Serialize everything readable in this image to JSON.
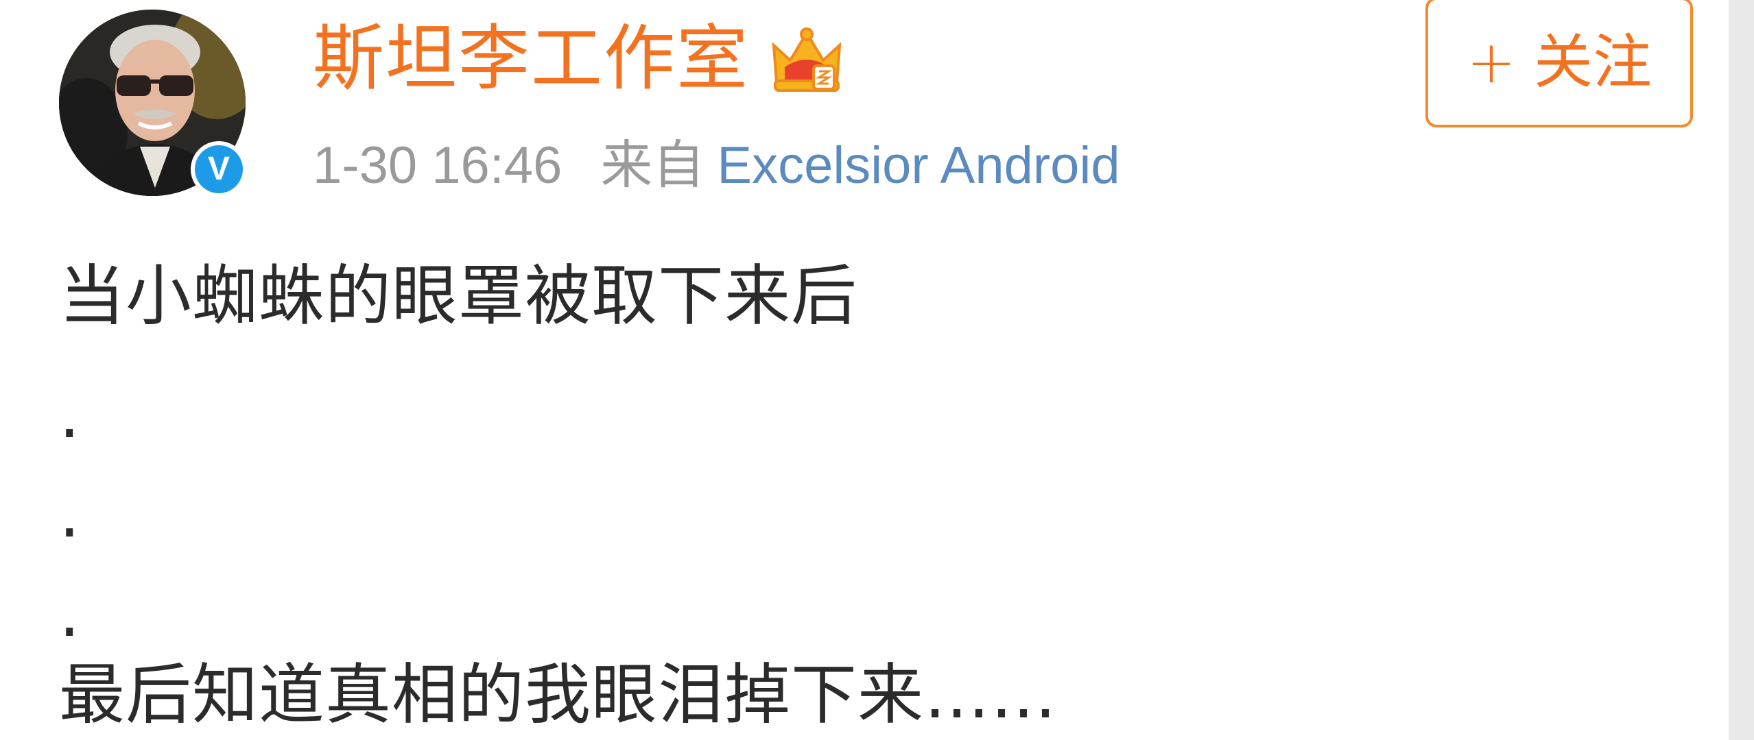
{
  "post": {
    "author": {
      "name": "斯坦李工作室",
      "verified_mark": "V",
      "badge_icon": "crown-member-icon",
      "avatar_icon": "avatar-photo"
    },
    "time": "1-30 16:46",
    "from_label": "来自",
    "source": "Excelsior Android",
    "follow_button": {
      "plus": "+",
      "label": "关注"
    },
    "text_lines": [
      "当小蜘蛛的眼罩被取下来后",
      ".",
      ".",
      ".",
      "最后知道真相的我眼泪掉下来……"
    ]
  },
  "colors": {
    "username": "#f4711f",
    "source_link": "#5a8ac0",
    "meta": "#9a9a9a",
    "verified": "#1e9be8",
    "follow_border": "#f58a2c",
    "body_text": "#2b2b2b"
  }
}
